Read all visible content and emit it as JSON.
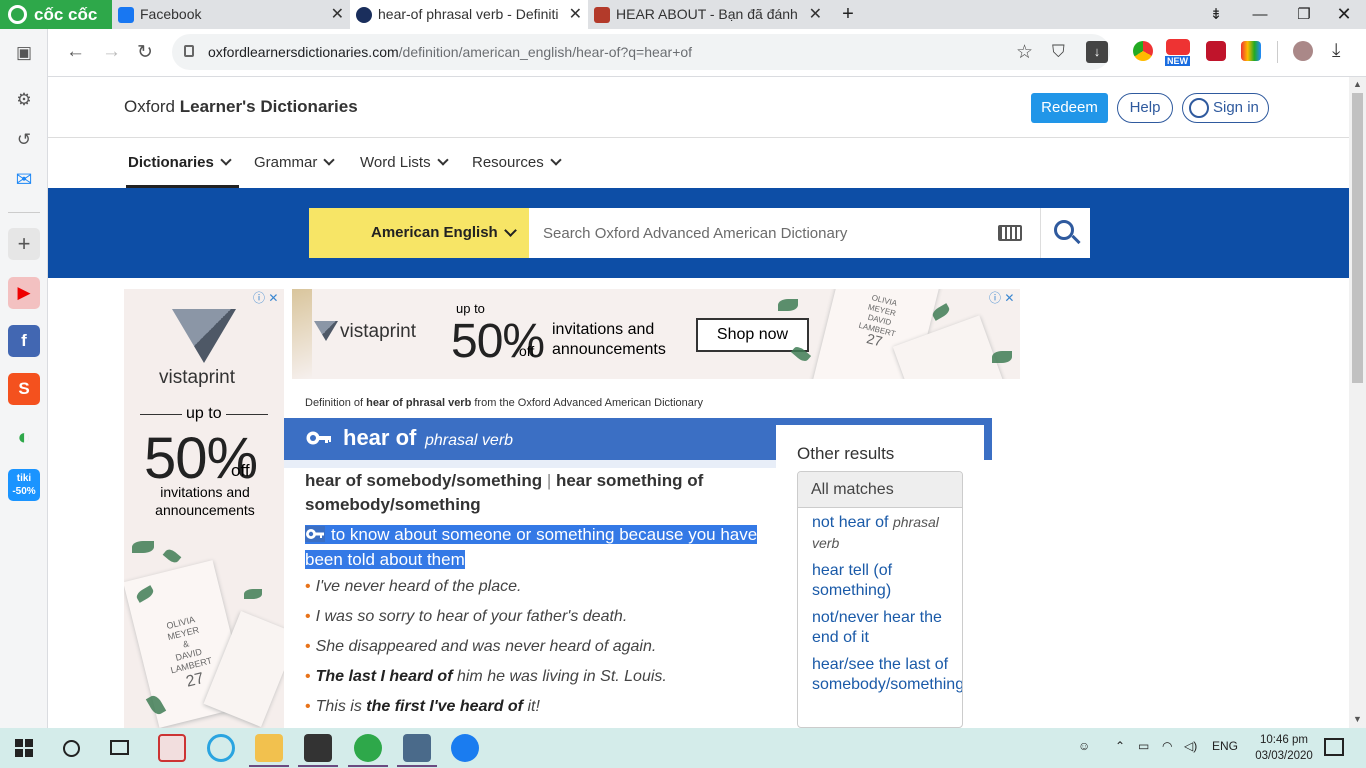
{
  "browser": {
    "brand": "cốc cốc",
    "tabs": [
      {
        "title": "Facebook",
        "active": false
      },
      {
        "title": "hear-of phrasal verb - Definiti",
        "active": true
      },
      {
        "title": "HEAR ABOUT - Bạn đã đánh v",
        "active": false
      }
    ],
    "new_tab": "+",
    "url_domain": "oxfordlearnersdictionaries.com",
    "url_path": "/definition/american_english/hear-of?q=hear+of",
    "ext_badge": "NEW"
  },
  "site": {
    "logo_light": "Oxford ",
    "logo_bold": "Learner's Dictionaries",
    "redeem": "Redeem",
    "help": "Help",
    "signin": "Sign in",
    "menu": [
      "Dictionaries",
      "Grammar",
      "Word Lists",
      "Resources"
    ],
    "dict_selector": "American English",
    "search_placeholder": "Search Oxford Advanced American Dictionary"
  },
  "ads": {
    "left": {
      "brand": "vistaprint",
      "line1": "up to",
      "big": "50%",
      "off": "off",
      "line2": "invitations and",
      "line3": "announcements",
      "card_name1": "OLIVIA",
      "card_name2": "MEYER",
      "card_and": "&",
      "card_name3": "DAVID",
      "card_name4": "LAMBERT",
      "card_date": "27"
    },
    "top": {
      "brand": "vistaprint",
      "line1": "up to",
      "big": "50%",
      "off": "off",
      "line2": "invitations and",
      "line3": "announcements",
      "cta": "Shop now",
      "card_name1": "OLIVIA",
      "card_name2": "MEYER",
      "card_name3": "DAVID",
      "card_name4": "LAMBERT",
      "card_date": "27"
    },
    "close": "ⓘ ✕"
  },
  "entry": {
    "source_pre": "Definition of ",
    "source_bold": "hear of phrasal verb",
    "source_post": " from the Oxford Advanced American Dictionary",
    "headword": "hear of",
    "pos": "phrasal verb",
    "sense_header_a": "hear of somebody/something",
    "sense_sep": " | ",
    "sense_header_b": "hear something of somebody/something",
    "definition": "to know about someone or something because you have been told about them",
    "examples": [
      {
        "pre": "I've never heard of the place.",
        "bold": "",
        "post": ""
      },
      {
        "pre": "I was so sorry to hear of your father's death.",
        "bold": "",
        "post": ""
      },
      {
        "pre": "She disappeared and was never heard of again.",
        "bold": "",
        "post": ""
      },
      {
        "pre": "",
        "bold": "The last I heard of",
        "post": " him he was living in St. Louis."
      },
      {
        "pre": "This is ",
        "bold": "the first I've heard of",
        "post": " it!"
      }
    ]
  },
  "other_results": {
    "title": "Other results",
    "header": "All matches",
    "items": [
      {
        "text": "not hear of",
        "pos": "phrasal verb"
      },
      {
        "text": "hear tell (of something)",
        "pos": ""
      },
      {
        "text": "not/never hear the end of it",
        "pos": ""
      },
      {
        "text": "hear/see the last of somebody/something",
        "pos": ""
      }
    ]
  },
  "taskbar": {
    "lang": "ENG",
    "time": "10:46 pm",
    "date": "03/03/2020",
    "apps": [
      "start",
      "search",
      "task-view",
      "app1",
      "app2",
      "file-explorer",
      "sticky",
      "coccoc",
      "app3",
      "zalo"
    ]
  },
  "colors": {
    "accent_blue": "#0d4ea6",
    "yellow": "#f7e566",
    "headword_bar": "#3b6fc4",
    "coccoc_green": "#2ea84a"
  }
}
